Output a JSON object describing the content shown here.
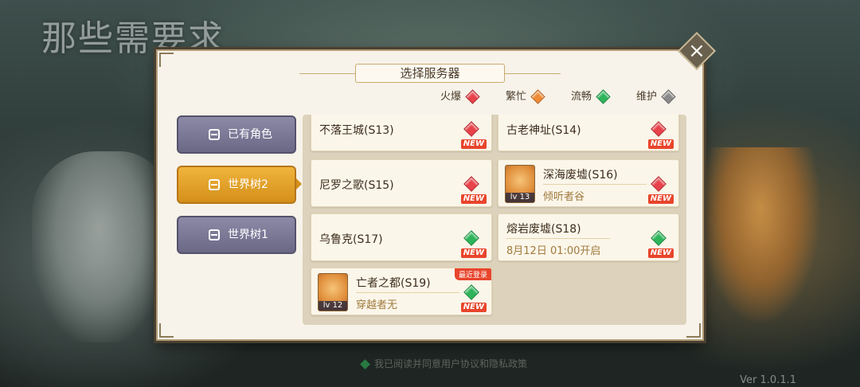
{
  "background": {
    "logo_text": "那些需要求",
    "hint_text": "我已阅读并同意用户协议和隐私政策",
    "version": "Ver 1.0.1.1"
  },
  "dialog": {
    "title": "选择服务器",
    "close_icon": "close-x-icon"
  },
  "legend": [
    {
      "label": "火爆",
      "color": "#e8424a"
    },
    {
      "label": "繁忙",
      "color": "#f08a34"
    },
    {
      "label": "流畅",
      "color": "#2eb45a"
    },
    {
      "label": "维护",
      "color": "#8a8a8a"
    }
  ],
  "tabs": [
    {
      "label": "已有角色",
      "active": false
    },
    {
      "label": "世界树2",
      "active": true
    },
    {
      "label": "世界树1",
      "active": false
    }
  ],
  "servers": [
    {
      "name": "不落王城(S13)",
      "status": "火爆",
      "new": "NEW"
    },
    {
      "name": "古老神址(S14)",
      "status": "火爆",
      "new": "NEW"
    },
    {
      "name": "尼罗之歌(S15)",
      "status": "火爆",
      "new": "NEW"
    },
    {
      "name": "深海废墟(S16)",
      "status": "火爆",
      "new": "NEW",
      "level": "lv 13",
      "character": "倾听者谷"
    },
    {
      "name": "乌鲁克(S17)",
      "status": "流畅",
      "new": "NEW"
    },
    {
      "name": "熔岩废墟(S18)",
      "status": "流畅",
      "new": "NEW",
      "open_time": "8月12日 01:00开启"
    },
    {
      "name": "亡者之都(S19)",
      "status": "流畅",
      "new": "NEW",
      "level": "lv 12",
      "character": "穿越者无",
      "badge": "最近登录"
    }
  ]
}
